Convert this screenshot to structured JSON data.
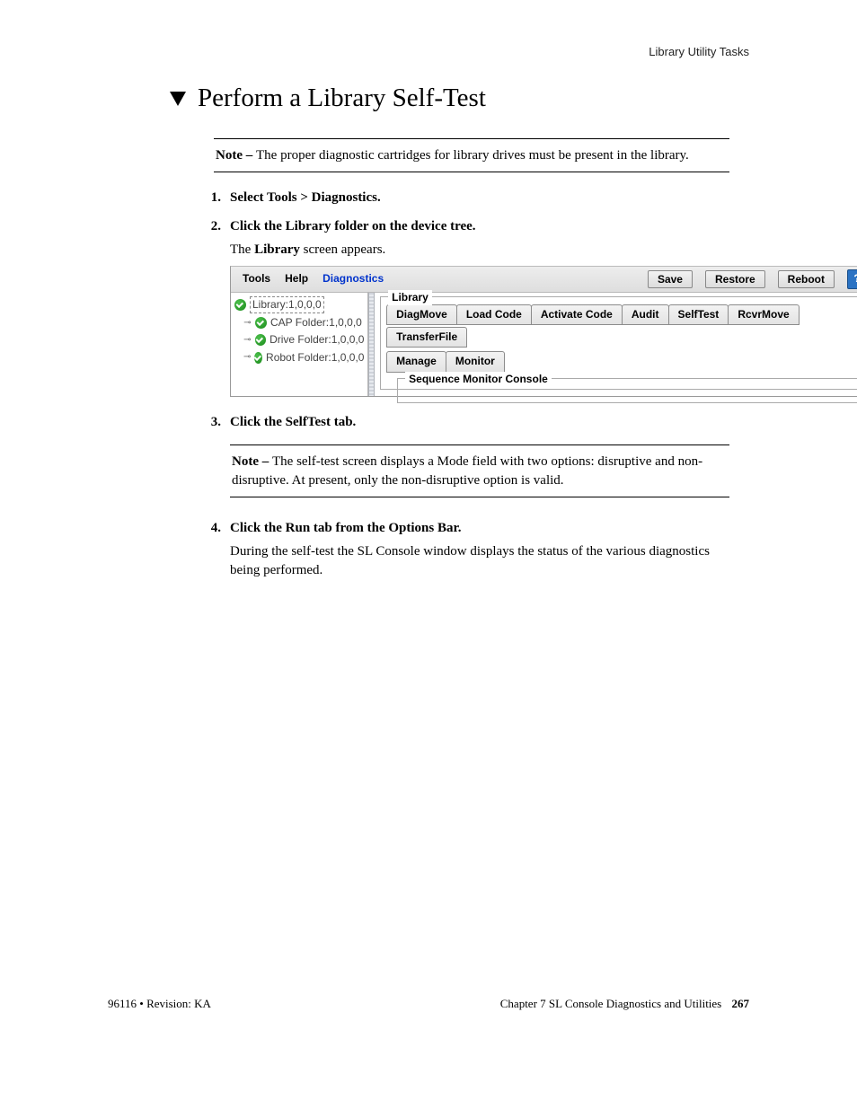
{
  "header": {
    "running": "Library Utility Tasks"
  },
  "title": "Perform a Library Self-Test",
  "notes": {
    "prefix": "Note – ",
    "n1": "The proper diagnostic cartridges for library drives must be present in the library.",
    "n2": "The self-test screen displays a Mode field with two options: disruptive and non-disruptive. At present, only the non-disruptive option is valid."
  },
  "steps": {
    "s1": "Select Tools > Diagnostics.",
    "s2": "Click the Library folder on the device tree.",
    "s2_after_a": "The ",
    "s2_after_b": "Library",
    "s2_after_c": " screen appears.",
    "s3": "Click the SelfTest tab.",
    "s4": "Click the Run tab from the Options Bar.",
    "s4_after": "During the self-test the SL Console window displays the status of the various diagnostics being performed."
  },
  "app": {
    "menus": {
      "tools": "Tools",
      "help": "Help",
      "diag": "Diagnostics"
    },
    "toolbar": {
      "save": "Save",
      "restore": "Restore",
      "reboot": "Reboot",
      "help": "?"
    },
    "tree": {
      "root": "Library:1,0,0,0",
      "cap": "CAP Folder:1,0,0,0",
      "drive": "Drive Folder:1,0,0,0",
      "robot": "Robot Folder:1,0,0,0"
    },
    "panel": {
      "legend": "Library",
      "tabs": {
        "diagmove": "DiagMove",
        "loadcode": "Load Code",
        "activate": "Activate Code",
        "audit": "Audit",
        "selftest": "SelfTest",
        "rcvrmove": "RcvrMove",
        "transfer": "TransferFile",
        "manage": "Manage",
        "monitor": "Monitor"
      },
      "inner_legend": "Sequence Monitor Console"
    }
  },
  "footer": {
    "left": "96116 • Revision: KA",
    "right_text": "Chapter 7 SL Console Diagnostics and Utilities",
    "page": "267"
  }
}
